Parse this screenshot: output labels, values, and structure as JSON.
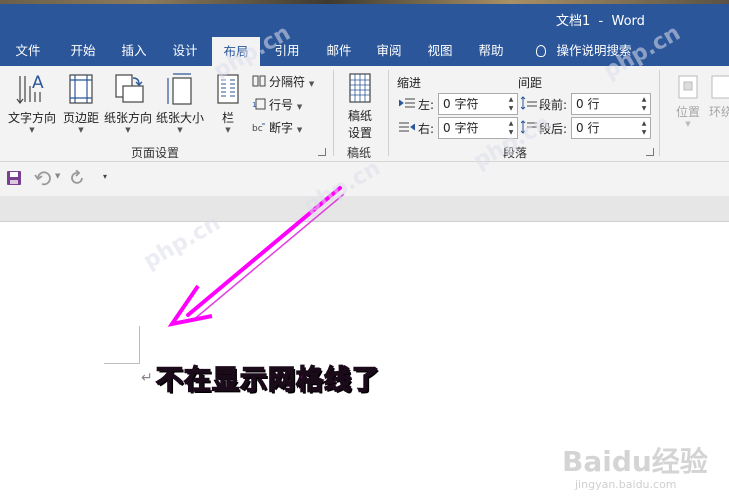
{
  "window": {
    "title": "文档1  -  Word"
  },
  "tabs": [
    {
      "label": "文件"
    },
    {
      "label": "开始"
    },
    {
      "label": "插入"
    },
    {
      "label": "设计"
    },
    {
      "label": "布局"
    },
    {
      "label": "引用"
    },
    {
      "label": "邮件"
    },
    {
      "label": "审阅"
    },
    {
      "label": "视图"
    },
    {
      "label": "帮助"
    },
    {
      "label": "操作说明搜索"
    }
  ],
  "active_tab": "布局",
  "ribbon": {
    "page_setup": {
      "text_direction": "文字方向",
      "margins": "页边距",
      "orientation": "纸张方向",
      "size": "纸张大小",
      "columns": "栏",
      "breaks": "分隔符",
      "line_numbers": "行号",
      "hyphenation": "断字",
      "group_label": "页面设置"
    },
    "manuscript": {
      "button_line1": "稿纸",
      "button_line2": "设置",
      "group_label": "稿纸"
    },
    "paragraph": {
      "indent_header": "缩进",
      "spacing_header": "间距",
      "left_label": "左:",
      "right_label": "右:",
      "before_label": "段前:",
      "after_label": "段后:",
      "left_value": "0 字符",
      "right_value": "0 字符",
      "before_value": "0 行",
      "after_value": "0 行",
      "group_label": "段落"
    },
    "arrange": {
      "position": "位置",
      "wrap": "环绕"
    }
  },
  "annotation": {
    "text": "不在显示网格线了"
  },
  "watermarks": {
    "site": "php.cn",
    "baidu": "Baidu经验",
    "baidu_url": "jingyan.baidu.com"
  },
  "colors": {
    "word_blue": "#2b579a",
    "annotation_magenta": "#d600d6",
    "arrow_magenta": "#ff00ff"
  }
}
